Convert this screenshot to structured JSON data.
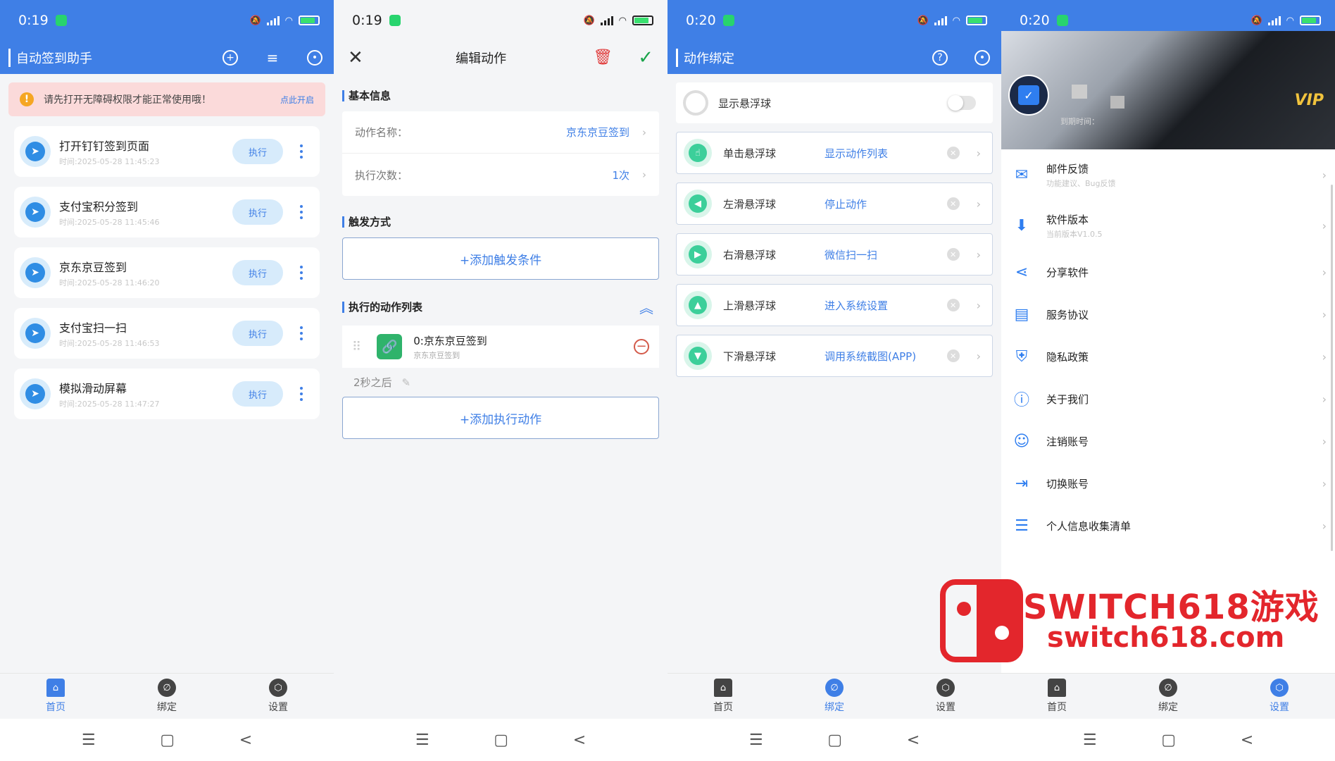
{
  "status": {
    "p1_time": "0:19",
    "p2_time": "0:19",
    "p3_time": "0:20",
    "p4_time": "0:20",
    "battery": "93"
  },
  "p1": {
    "title": "自动签到助手",
    "warning": "请先打开无障碍权限才能正常使用哦！",
    "warning_link": "点此开启",
    "exec_label": "执行",
    "tasks": [
      {
        "name": "打开钉钉签到页面",
        "time": "时间:2025-05-28 11:45:23"
      },
      {
        "name": "支付宝积分签到",
        "time": "时间:2025-05-28 11:45:46"
      },
      {
        "name": "京东京豆签到",
        "time": "时间:2025-05-28 11:46:20"
      },
      {
        "name": "支付宝扫一扫",
        "time": "时间:2025-05-28 11:46:53"
      },
      {
        "name": "模拟滑动屏幕",
        "time": "时间:2025-05-28 11:47:27"
      }
    ]
  },
  "p2": {
    "title": "编辑动作",
    "section_basic": "基本信息",
    "name_label": "动作名称：",
    "name_value": "京东京豆签到",
    "count_label": "执行次数：",
    "count_value": "1次",
    "section_trigger": "触发方式",
    "add_trigger": "+添加触发条件",
    "section_actions": "执行的动作列表",
    "action_name": "0:京东京豆签到",
    "action_sub": "京东京豆签到",
    "delay": "2秒之后",
    "add_action": "+添加执行动作"
  },
  "p3": {
    "title": "动作绑定",
    "toggle_label": "显示悬浮球",
    "bindings": [
      {
        "name": "单击悬浮球",
        "value": "显示动作列表"
      },
      {
        "name": "左滑悬浮球",
        "value": "停止动作"
      },
      {
        "name": "右滑悬浮球",
        "value": "微信扫一扫"
      },
      {
        "name": "上滑悬浮球",
        "value": "进入系统设置"
      },
      {
        "name": "下滑悬浮球",
        "value": "调用系统截图(APP)"
      }
    ]
  },
  "p4": {
    "expire_label": "到期时间：",
    "vip": "VIP",
    "menu": [
      {
        "name": "邮件反馈",
        "sub": "功能建议、Bug反馈",
        "icon": "mail-icon"
      },
      {
        "name": "软件版本",
        "sub": "当前版本V1.0.5",
        "icon": "download-icon"
      },
      {
        "name": "分享软件",
        "sub": "",
        "icon": "share-icon"
      },
      {
        "name": "服务协议",
        "sub": "",
        "icon": "document-icon"
      },
      {
        "name": "隐私政策",
        "sub": "",
        "icon": "shield-icon"
      },
      {
        "name": "关于我们",
        "sub": "",
        "icon": "info-icon"
      },
      {
        "name": "注销账号",
        "sub": "",
        "icon": "user-icon"
      },
      {
        "name": "切换账号",
        "sub": "",
        "icon": "switch-account-icon"
      },
      {
        "name": "个人信息收集清单",
        "sub": "",
        "icon": "list-icon"
      }
    ]
  },
  "nav": {
    "home": "首页",
    "bind": "绑定",
    "settings": "设置"
  },
  "watermark": {
    "line1": "SWITCH618游戏",
    "line2": "switch618.com"
  },
  "colors": {
    "primary": "#3f7fe6",
    "accent_green": "#3ccf9a",
    "warning_bg": "#fbdada",
    "danger": "#e03c3c"
  }
}
